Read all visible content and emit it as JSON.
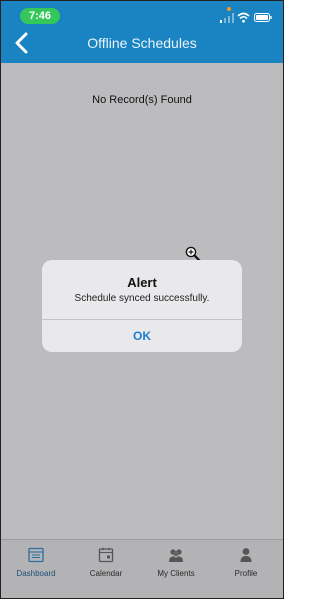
{
  "status_bar": {
    "time": "7:46"
  },
  "header": {
    "title": "Offline Schedules",
    "back_icon": "chevron-left-icon"
  },
  "content": {
    "empty_message": "No Record(s) Found"
  },
  "alert": {
    "title": "Alert",
    "message": "Schedule synced successfully.",
    "ok_label": "OK"
  },
  "tabbar": {
    "items": [
      {
        "label": "Dashboard",
        "icon": "dashboard-icon"
      },
      {
        "label": "Calendar",
        "icon": "calendar-icon"
      },
      {
        "label": "My Clients",
        "icon": "clients-icon"
      },
      {
        "label": "Profile",
        "icon": "profile-icon"
      }
    ]
  },
  "colors": {
    "header_blue": "#1a84c2",
    "status_green": "#35c759",
    "link_blue": "#1a7fd0",
    "overlay_gray": "#bcbcbf"
  }
}
